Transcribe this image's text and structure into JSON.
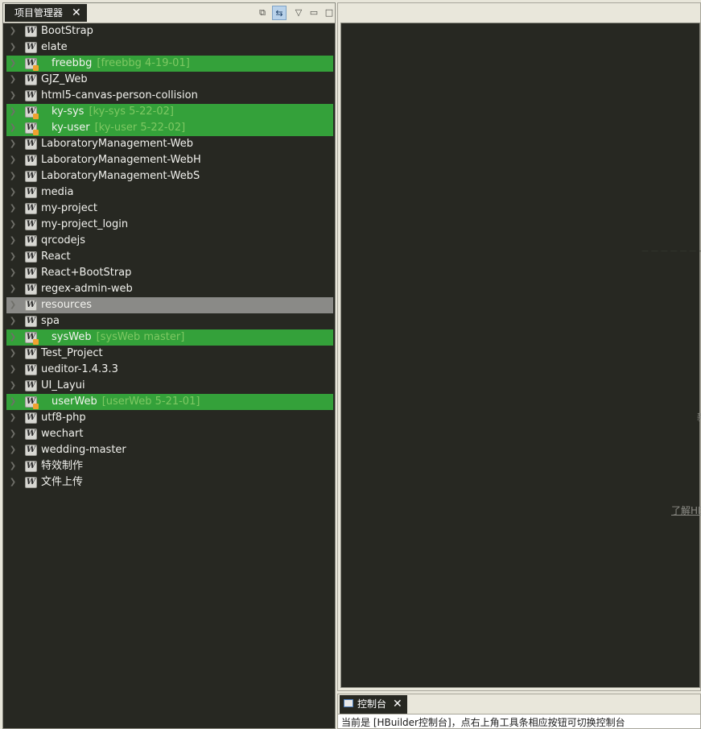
{
  "explorer": {
    "tab_label": "项目管理器",
    "close_glyph": "✕",
    "toolbar": [
      {
        "name": "collapse-all-icon",
        "glyph": "⧉"
      },
      {
        "name": "link-with-editor-icon",
        "glyph": "⇆"
      },
      {
        "name": "view-menu-icon",
        "glyph": "▽"
      },
      {
        "name": "minimize-icon",
        "glyph": "▭"
      },
      {
        "name": "maximize-icon",
        "glyph": "□"
      }
    ],
    "projects": [
      {
        "label": "BootStrap",
        "state": "normal",
        "branch": ""
      },
      {
        "label": "elate",
        "state": "normal",
        "branch": ""
      },
      {
        "label": "freebbg",
        "state": "git",
        "branch": "[freebbg 4-19-01]"
      },
      {
        "label": "GJZ_Web",
        "state": "normal",
        "branch": ""
      },
      {
        "label": "html5-canvas-person-collision",
        "state": "normal",
        "branch": ""
      },
      {
        "label": "ky-sys",
        "state": "git",
        "branch": "[ky-sys 5-22-02]"
      },
      {
        "label": "ky-user",
        "state": "git",
        "branch": "[ky-user 5-22-02]"
      },
      {
        "label": "LaboratoryManagement-Web",
        "state": "normal",
        "branch": ""
      },
      {
        "label": "LaboratoryManagement-WebH",
        "state": "normal",
        "branch": ""
      },
      {
        "label": "LaboratoryManagement-WebS",
        "state": "normal",
        "branch": ""
      },
      {
        "label": "media",
        "state": "normal",
        "branch": ""
      },
      {
        "label": "my-project",
        "state": "normal",
        "branch": ""
      },
      {
        "label": "my-project_login",
        "state": "normal",
        "branch": ""
      },
      {
        "label": "qrcodejs",
        "state": "normal",
        "branch": ""
      },
      {
        "label": "React",
        "state": "normal",
        "branch": ""
      },
      {
        "label": "React+BootStrap",
        "state": "normal",
        "branch": ""
      },
      {
        "label": "regex-admin-web",
        "state": "normal",
        "branch": ""
      },
      {
        "label": "resources",
        "state": "selected",
        "branch": ""
      },
      {
        "label": "spa",
        "state": "normal",
        "branch": ""
      },
      {
        "label": "sysWeb",
        "state": "git",
        "branch": "[sysWeb master]"
      },
      {
        "label": "Test_Project",
        "state": "normal",
        "branch": ""
      },
      {
        "label": "ueditor-1.4.3.3",
        "state": "normal",
        "branch": ""
      },
      {
        "label": "UI_Layui",
        "state": "normal",
        "branch": ""
      },
      {
        "label": "userWeb",
        "state": "git",
        "branch": "[userWeb 5-21-01]"
      },
      {
        "label": "utf8-php",
        "state": "normal",
        "branch": ""
      },
      {
        "label": "wechart",
        "state": "normal",
        "branch": ""
      },
      {
        "label": "wedding-master",
        "state": "normal",
        "branch": ""
      },
      {
        "label": "特效制作",
        "state": "normal",
        "branch": ""
      },
      {
        "label": "文件上传",
        "state": "normal",
        "branch": ""
      }
    ]
  },
  "editor": {
    "hint_new": "新",
    "hint_learn": "了解HB"
  },
  "console": {
    "tab_label": "控制台",
    "close_glyph": "✕",
    "message": "当前是 [HBuilder控制台]，点右上角工具条相应按钮可切换控制台"
  },
  "colors": {
    "dark_bg": "#272822",
    "git_row": "#34a13a",
    "selected_row": "#8a8a87",
    "chrome": "#e9e7db"
  }
}
